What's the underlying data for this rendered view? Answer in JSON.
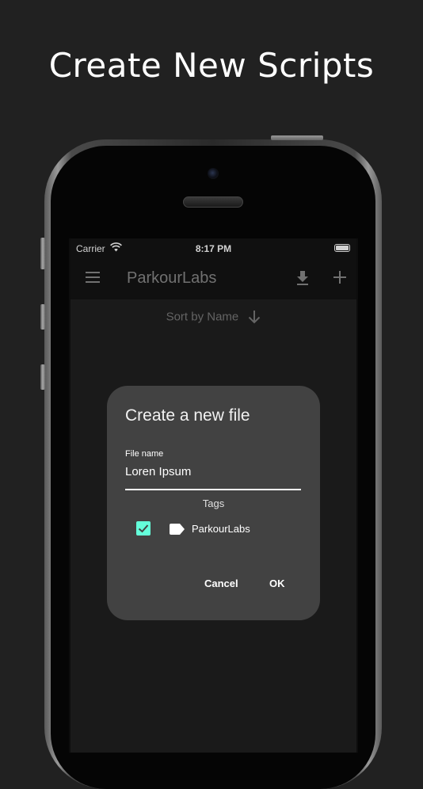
{
  "headline": "Create New Scripts",
  "status_bar": {
    "carrier": "Carrier",
    "time": "8:17 PM"
  },
  "app_bar": {
    "title": "ParkourLabs",
    "menu_icon": "menu-icon",
    "download_icon": "download-icon",
    "add_icon": "add-icon"
  },
  "sort": {
    "label": "Sort by Name",
    "direction_icon": "arrow-down-icon"
  },
  "dialog": {
    "title": "Create a new file",
    "file_name_label": "File name",
    "file_name_value": "Loren Ipsum",
    "tags_label": "Tags",
    "tags": [
      {
        "name": "ParkourLabs",
        "checked": true
      }
    ],
    "cancel_label": "Cancel",
    "ok_label": "OK"
  },
  "colors": {
    "background": "#212121",
    "dialog": "#424242",
    "accent": "#64ffda",
    "app_bar": "#141414"
  }
}
